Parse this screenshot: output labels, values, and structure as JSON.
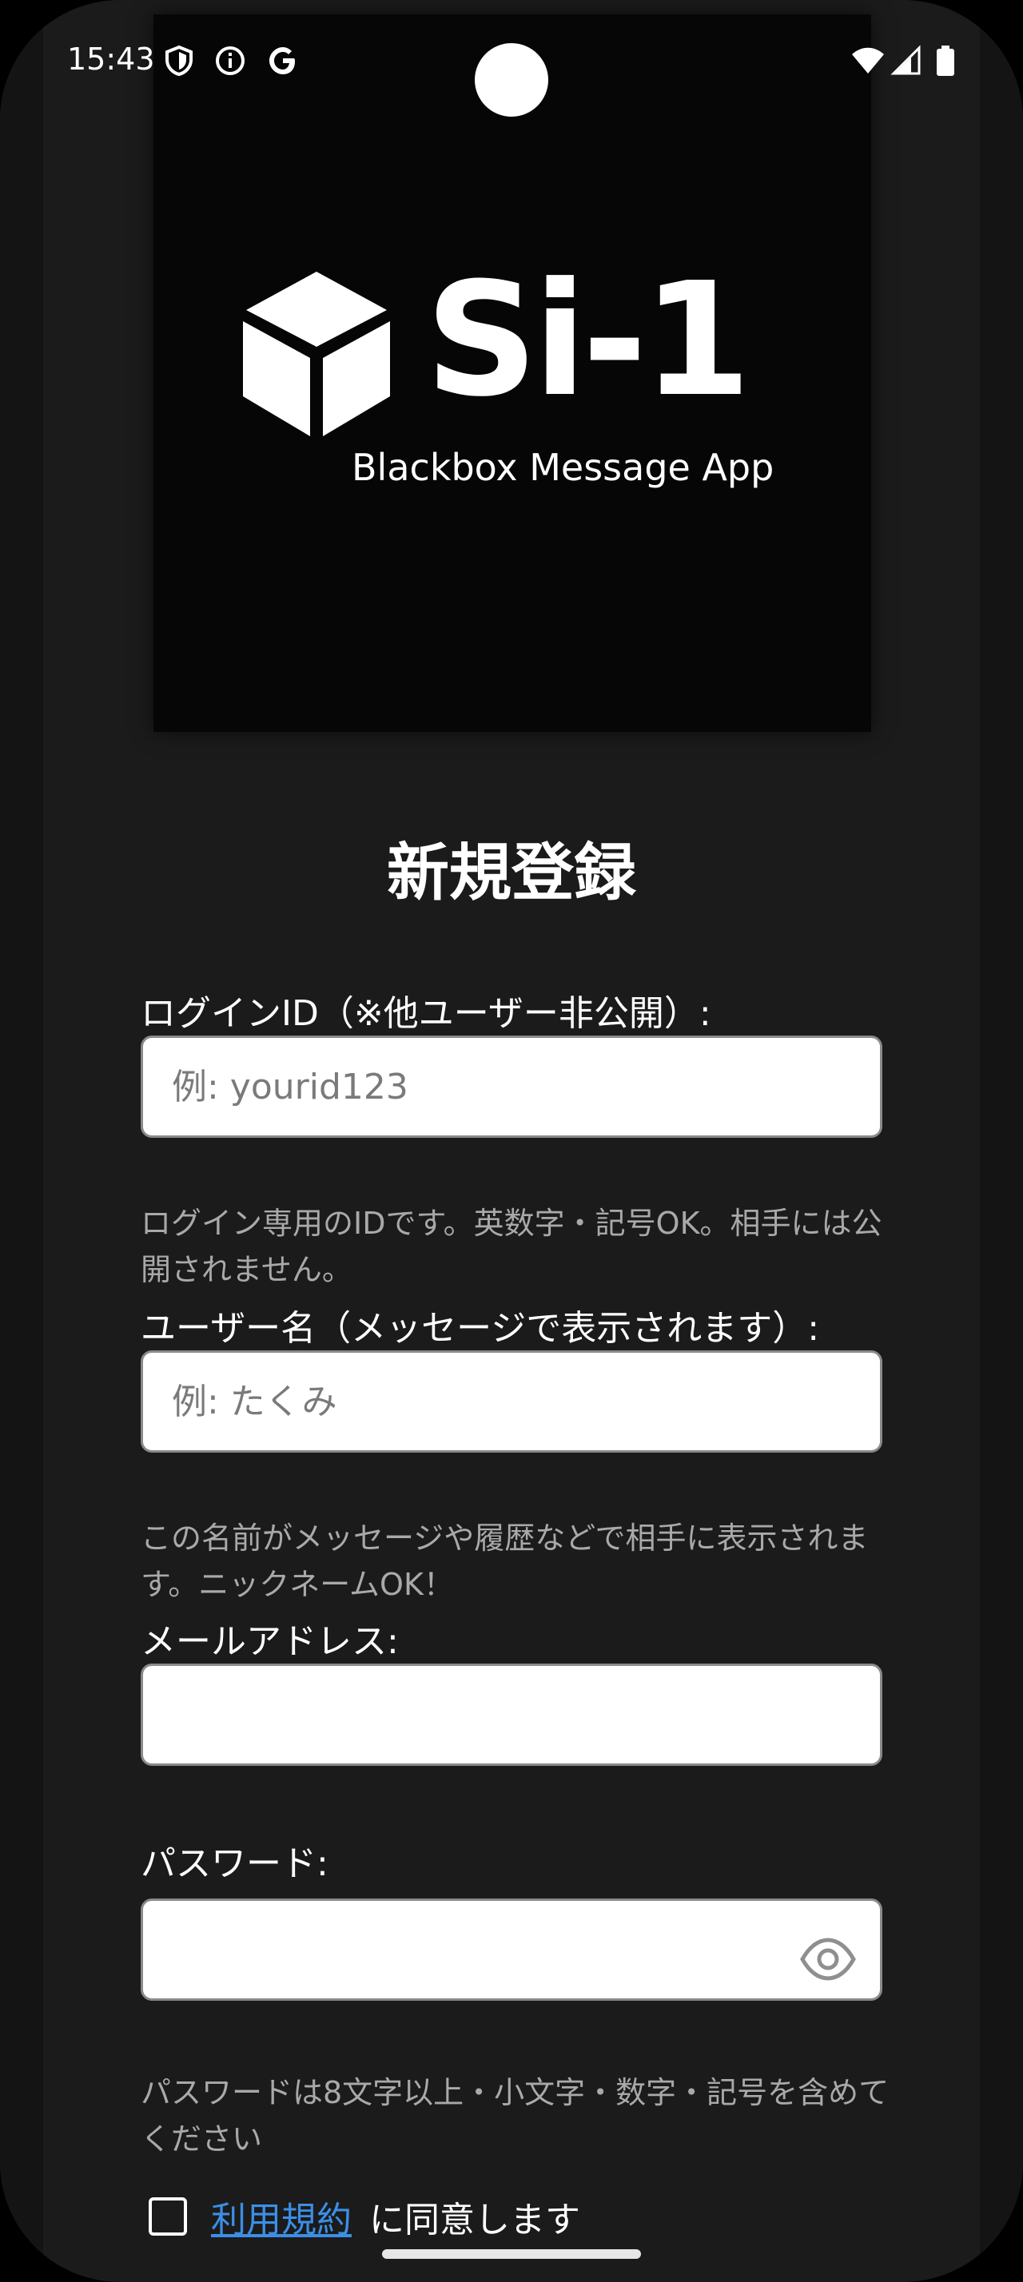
{
  "status_bar": {
    "time": "15:43",
    "icons": [
      "shield-icon",
      "info-icon",
      "google-g-icon",
      "wifi-icon",
      "signal-icon",
      "battery-icon"
    ]
  },
  "hero": {
    "logo_title": "Si-1",
    "logo_subtitle": "Blackbox Message App"
  },
  "form": {
    "title": "新規登録",
    "login_id": {
      "label": "ログインID（※他ユーザー非公開）:",
      "placeholder": "例: yourid123",
      "value": "",
      "hint": "ログイン専用のIDです。英数字・記号OK。相手には公開されません。"
    },
    "username": {
      "label": "ユーザー名（メッセージで表示されます）:",
      "placeholder": "例: たくみ",
      "value": "",
      "hint": "この名前がメッセージや履歴などで相手に表示されます。ニックネームOK！"
    },
    "email": {
      "label": "メールアドレス:",
      "placeholder": "",
      "value": ""
    },
    "password": {
      "label": "パスワード:",
      "placeholder": "",
      "value": "",
      "toggle_icon": "eye-icon",
      "hint": "パスワードは8文字以上・小文字・数字・記号を含めてください"
    },
    "terms": {
      "checked": false,
      "link_text": "利用規約",
      "suffix": "に同意します"
    }
  },
  "colors": {
    "background": "#1b1b1c",
    "hero_background": "#060606",
    "link": "#3b8fe6",
    "hint_text": "#a9a9a9"
  }
}
